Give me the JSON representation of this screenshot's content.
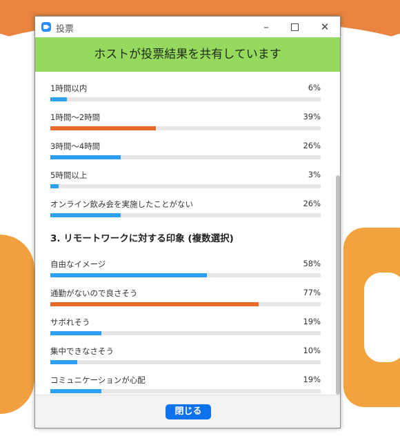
{
  "window": {
    "title": "投票",
    "banner": "ホストが投票結果を共有しています",
    "close_button": "閉じる"
  },
  "colors": {
    "bar_blue": "#2da0f2",
    "bar_orange": "#e86a2a",
    "banner_green": "#95d95e",
    "button_blue": "#0e72ed"
  },
  "poll": {
    "q2_options": [
      {
        "label": "1時間以内",
        "percent": "6%",
        "value": 6,
        "highlight": false
      },
      {
        "label": "1時間～2時間",
        "percent": "39%",
        "value": 39,
        "highlight": true
      },
      {
        "label": "3時間～4時間",
        "percent": "26%",
        "value": 26,
        "highlight": false
      },
      {
        "label": "5時間以上",
        "percent": "3%",
        "value": 3,
        "highlight": false
      },
      {
        "label": "オンライン飲み会を実施したことがない",
        "percent": "26%",
        "value": 26,
        "highlight": false
      }
    ],
    "q3_title": "3. リモートワークに対する印象 (複数選択)",
    "q3_options": [
      {
        "label": "自由なイメージ",
        "percent": "58%",
        "value": 58,
        "highlight": false
      },
      {
        "label": "通勤がないので良さそう",
        "percent": "77%",
        "value": 77,
        "highlight": true
      },
      {
        "label": "サボれそう",
        "percent": "19%",
        "value": 19,
        "highlight": false
      },
      {
        "label": "集中できなさそう",
        "percent": "10%",
        "value": 10,
        "highlight": false
      },
      {
        "label": "コミュニケーションが心配",
        "percent": "19%",
        "value": 19,
        "highlight": false
      }
    ]
  }
}
